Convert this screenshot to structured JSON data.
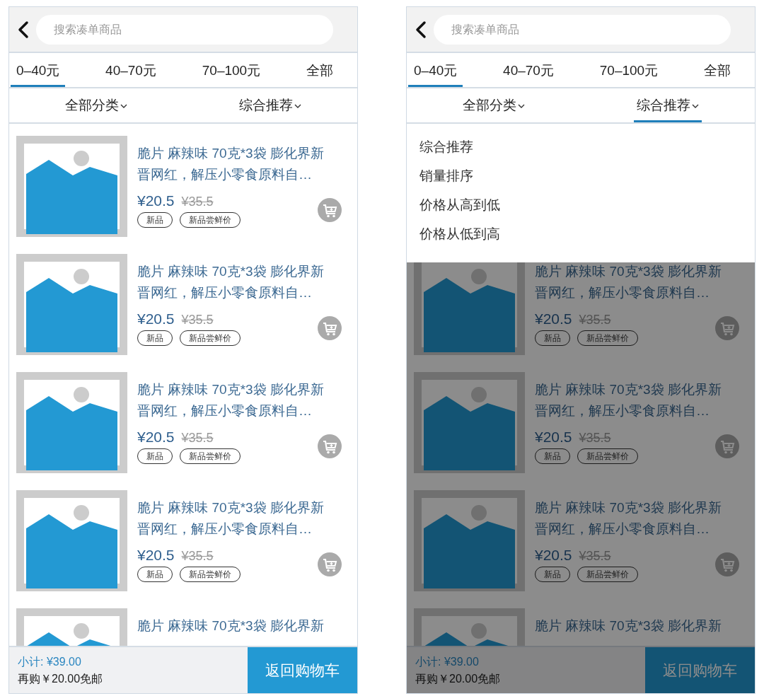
{
  "screens": [
    {
      "search": {
        "placeholder": "搜索凑单商品"
      },
      "price_tabs": [
        {
          "label": "0–40元",
          "selected": true
        },
        {
          "label": "40–70元",
          "selected": false
        },
        {
          "label": "70–100元",
          "selected": false
        },
        {
          "label": "全部",
          "selected": false
        }
      ],
      "filters": [
        {
          "label": "全部分类",
          "expanded": false
        },
        {
          "label": "综合推荐",
          "expanded": false
        }
      ],
      "products": [
        {
          "title_lines": [
            "脆片 麻辣味 70克*3袋 膨化界新",
            "晋网红，解压小零食原料自…"
          ],
          "price": "¥20.5",
          "original_price": "¥35.5",
          "tags": [
            "新品",
            "新品尝鲜价"
          ]
        },
        {
          "title_lines": [
            "脆片 麻辣味 70克*3袋 膨化界新",
            "晋网红，解压小零食原料自…"
          ],
          "price": "¥20.5",
          "original_price": "¥35.5",
          "tags": [
            "新品",
            "新品尝鲜价"
          ]
        },
        {
          "title_lines": [
            "脆片 麻辣味 70克*3袋 膨化界新",
            "晋网红，解压小零食原料自…"
          ],
          "price": "¥20.5",
          "original_price": "¥35.5",
          "tags": [
            "新品",
            "新品尝鲜价"
          ]
        },
        {
          "title_lines": [
            "脆片 麻辣味 70克*3袋 膨化界新",
            "晋网红，解压小零食原料自…"
          ],
          "price": "¥20.5",
          "original_price": "¥35.5",
          "tags": [
            "新品",
            "新品尝鲜价"
          ]
        },
        {
          "title_lines": [
            "脆片 麻辣味 70克*3袋 膨化界新"
          ]
        }
      ],
      "footer": {
        "subtotal": "小计: ¥39.00",
        "free_shipping_note": "再购￥20.00免邮",
        "button": "返回购物车"
      }
    },
    {
      "search": {
        "placeholder": "搜索凑单商品"
      },
      "price_tabs": [
        {
          "label": "0–40元",
          "selected": true
        },
        {
          "label": "40–70元",
          "selected": false
        },
        {
          "label": "70–100元",
          "selected": false
        },
        {
          "label": "全部",
          "selected": false
        }
      ],
      "filters": [
        {
          "label": "全部分类",
          "expanded": false
        },
        {
          "label": "综合推荐",
          "expanded": true
        }
      ],
      "sort_menu": [
        "综合推荐",
        "销量排序",
        "价格从高到低",
        "价格从低到高"
      ],
      "products": [
        {
          "title_lines": [
            "脆片 麻辣味 70克*3袋 膨化界新",
            "晋网红，解压小零食原料自…"
          ],
          "price": "¥20.5",
          "original_price": "¥35.5",
          "tags": [
            "新品",
            "新品尝鲜价"
          ]
        },
        {
          "title_lines": [
            "脆片 麻辣味 70克*3袋 膨化界新",
            "晋网红，解压小零食原料自…"
          ],
          "price": "¥20.5",
          "original_price": "¥35.5",
          "tags": [
            "新品",
            "新品尝鲜价"
          ]
        },
        {
          "title_lines": [
            "脆片 麻辣味 70克*3袋 膨化界新",
            "晋网红，解压小零食原料自…"
          ],
          "price": "¥20.5",
          "original_price": "¥35.5",
          "tags": [
            "新品",
            "新品尝鲜价"
          ]
        },
        {
          "title_lines": [
            "脆片 麻辣味 70克*3袋 膨化界新"
          ]
        }
      ],
      "footer": {
        "subtotal": "小计: ¥39.00",
        "free_shipping_note": "再购￥20.00免邮",
        "button": "返回购物车"
      }
    }
  ]
}
